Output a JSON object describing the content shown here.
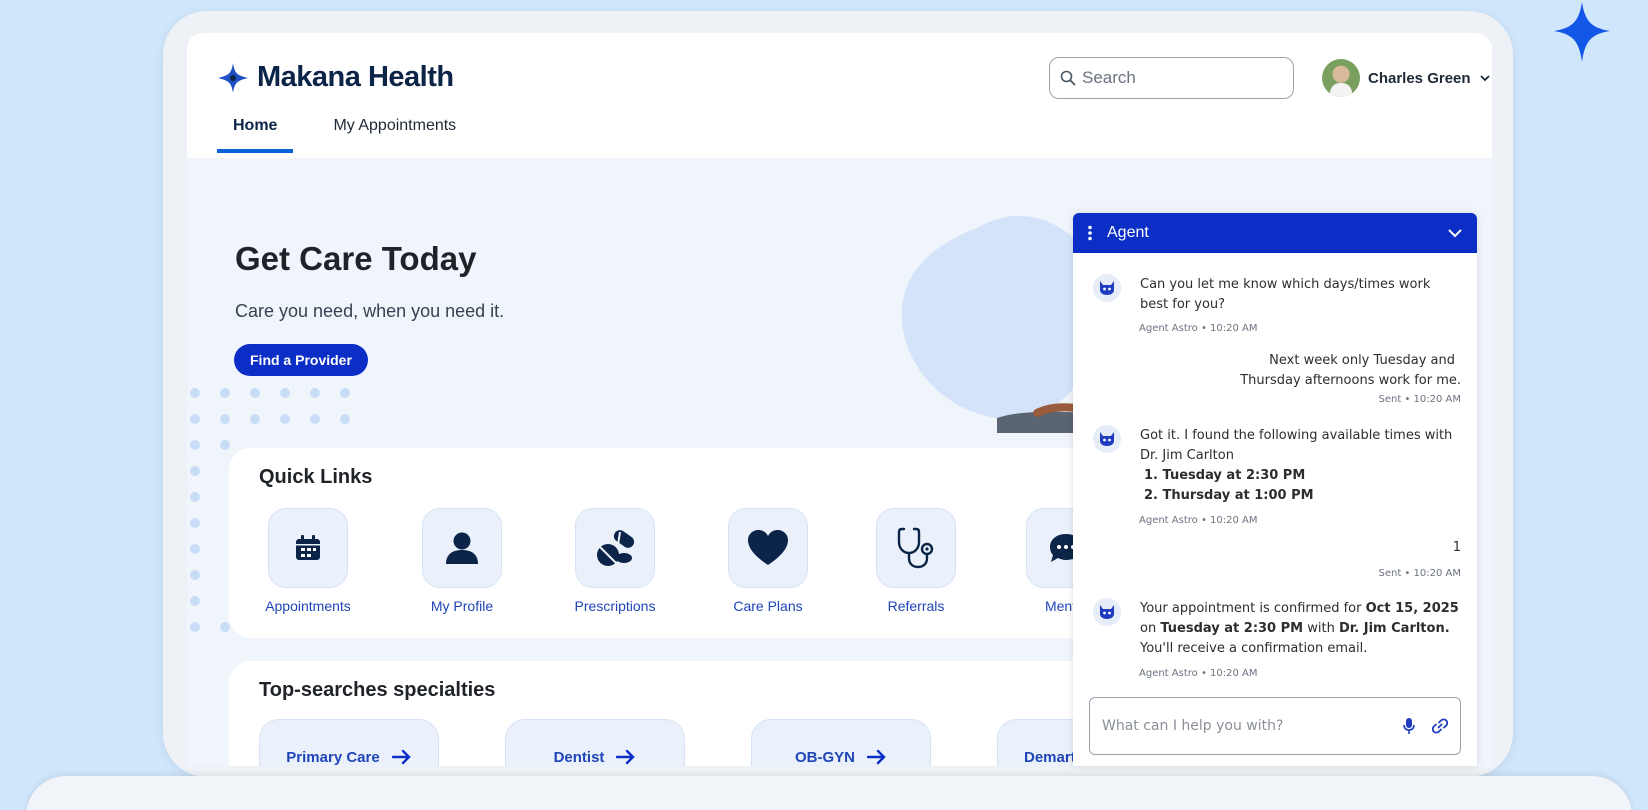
{
  "brand": {
    "name": "Makana Health"
  },
  "search": {
    "placeholder": "Search"
  },
  "user": {
    "name": "Charles Green"
  },
  "tabs": [
    {
      "label": "Home",
      "active": true
    },
    {
      "label": "My Appointments",
      "active": false
    }
  ],
  "hero": {
    "title": "Get Care Today",
    "subtitle": "Care you need, when you need it.",
    "cta": "Find a Provider"
  },
  "quick_links": {
    "title": "Quick Links",
    "items": [
      {
        "label": "Appointments",
        "icon": "calendar-icon"
      },
      {
        "label": "My Profile",
        "icon": "person-icon"
      },
      {
        "label": "Prescriptions",
        "icon": "pills-icon"
      },
      {
        "label": "Care Plans",
        "icon": "heart-icon"
      },
      {
        "label": "Referrals",
        "icon": "stethoscope-icon"
      },
      {
        "label": "Mental",
        "icon": "chat-icon"
      }
    ]
  },
  "specialties": {
    "title": "Top-searches specialties",
    "items": [
      "Primary Care",
      "Dentist",
      "OB-GYN",
      "Demart"
    ]
  },
  "agent": {
    "title": "Agent",
    "messages": [
      {
        "from": "agent",
        "text": "Can you let me know which days/times work best for you?",
        "meta": "Agent Astro • 10:20 AM"
      },
      {
        "from": "user",
        "line1": "Next week only Tuesday and",
        "line2": "Thursday afternoons work for me.",
        "meta": "Sent • 10:20 AM"
      },
      {
        "from": "agent",
        "intro": "Got it. I found the following available times with Dr. Jim Carlton",
        "options": [
          "1. Tuesday at 2:30 PM",
          "2. Thursday at 1:00 PM"
        ],
        "meta": "Agent Astro • 10:20 AM"
      },
      {
        "from": "user",
        "text": "1",
        "meta": "Sent • 10:20 AM"
      },
      {
        "from": "agent",
        "p1": "Your appointment is confirmed for ",
        "date": "Oct 15, 2025",
        "p2": " on ",
        "time": "Tuesday at 2:30 PM",
        "p3": " with ",
        "doctor": "Dr. Jim Carlton.",
        "p4": " You'll receive a confirmation email.",
        "meta": "Agent Astro • 10:20 AM"
      }
    ],
    "composer_placeholder": "What can I help you with?"
  },
  "colors": {
    "primary": "#0b2ec7",
    "navy": "#0b2447",
    "link": "#1f45b8",
    "page_bg": "#cfe6fb"
  }
}
